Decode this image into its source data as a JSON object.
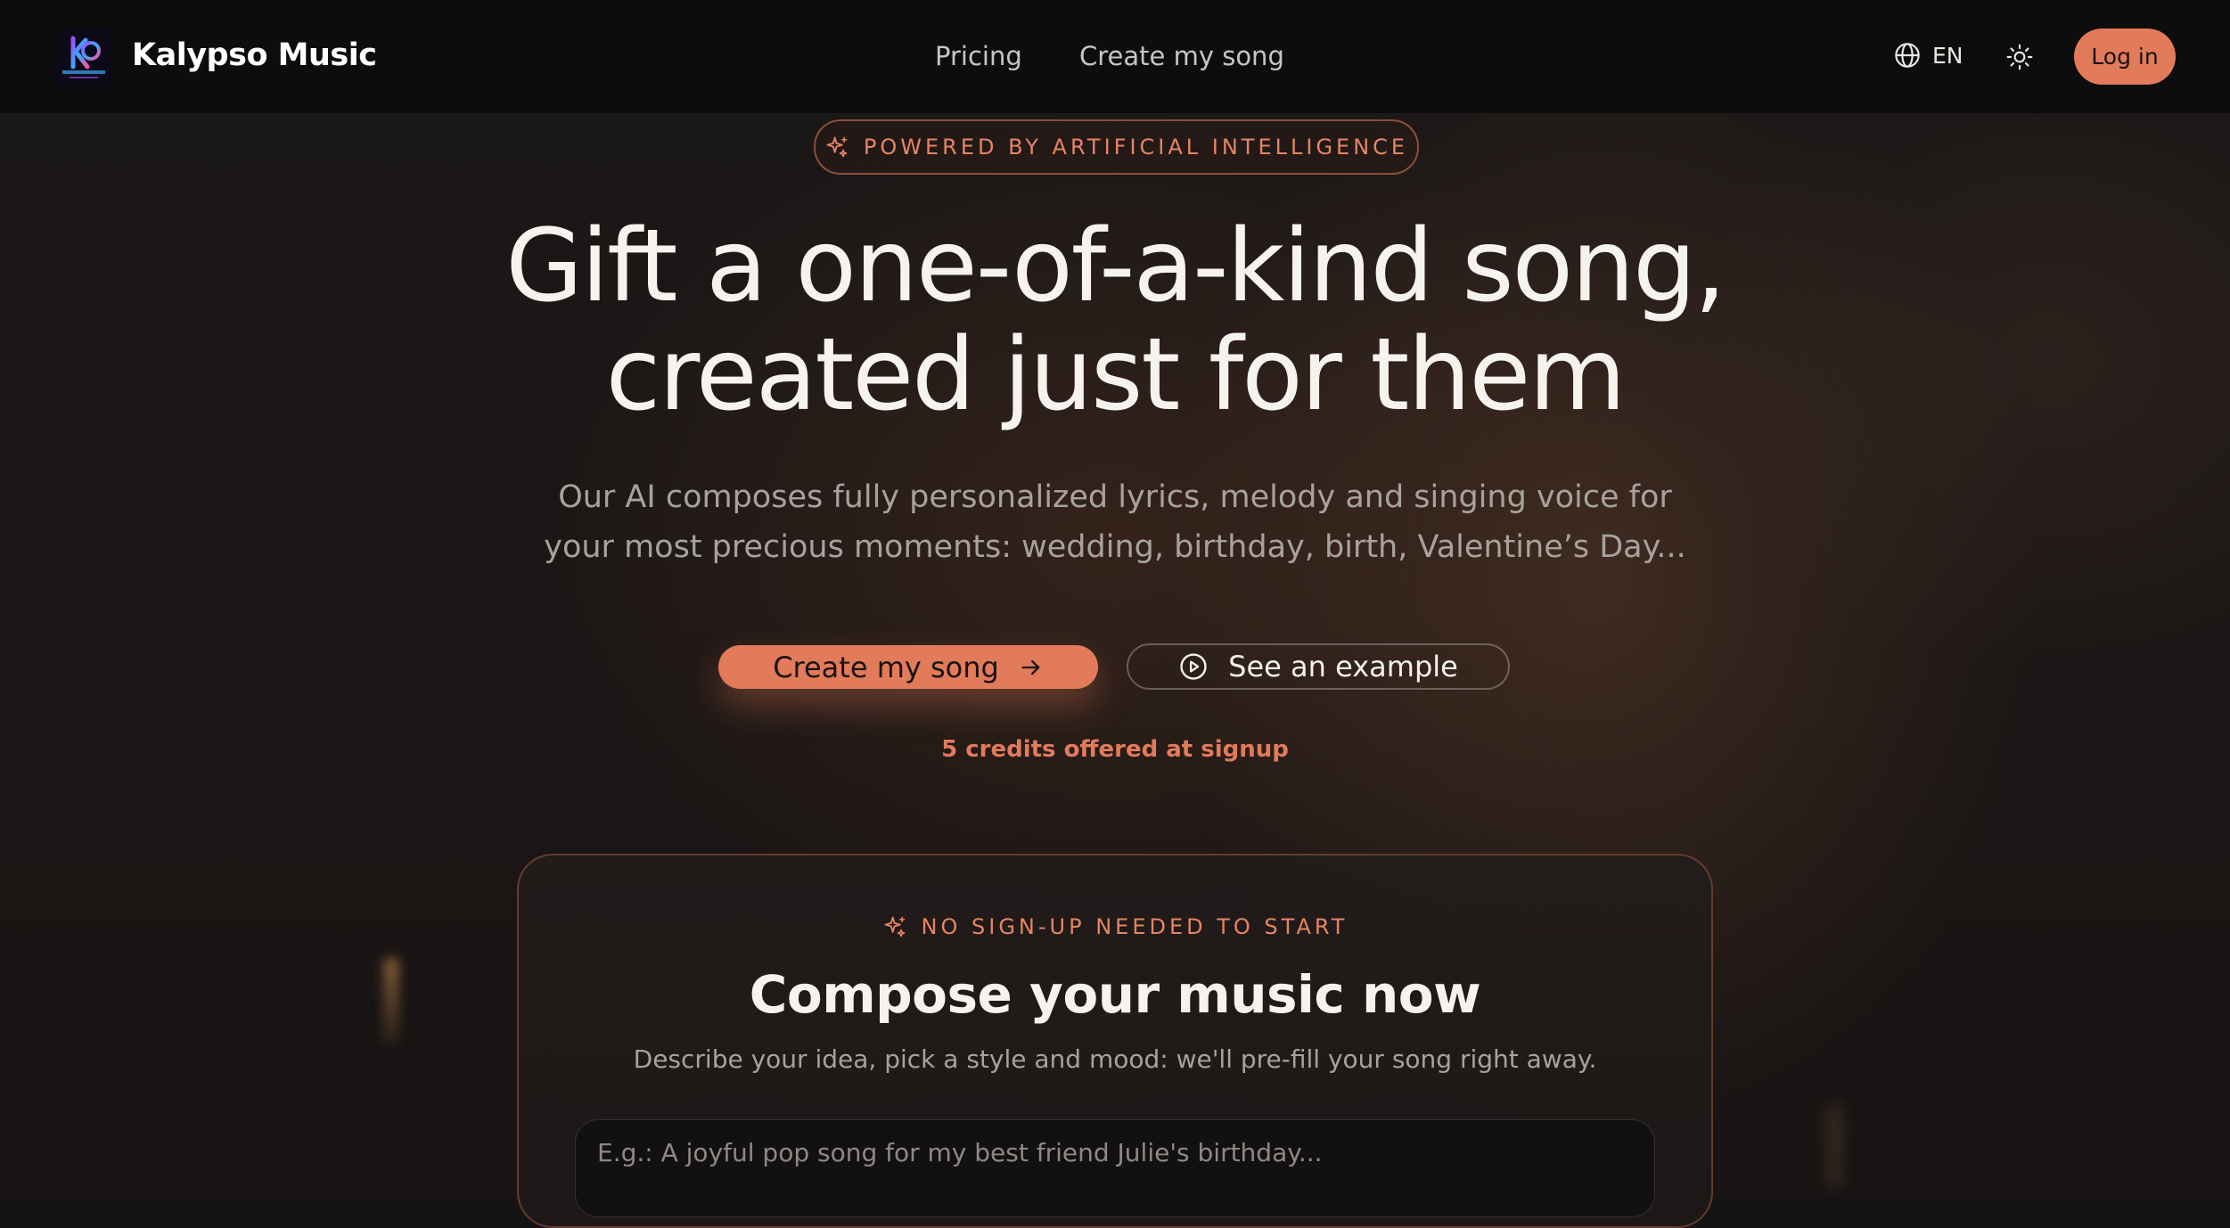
{
  "header": {
    "brand": "Kalypso Music",
    "logo_alt": "KALYPSO",
    "nav": [
      {
        "label": "Pricing"
      },
      {
        "label": "Create my song"
      }
    ],
    "language": "EN",
    "login_label": "Log in"
  },
  "hero": {
    "badge": "POWERED BY ARTIFICIAL INTELLIGENCE",
    "title_line1": "Gift a one-of-a-kind song,",
    "title_line2": "created just for them",
    "subtitle_line1": "Our AI composes fully personalized lyrics, melody and singing voice for",
    "subtitle_line2": "your most precious moments: wedding, birthday, birth, Valentine’s Day...",
    "primary_cta": "Create my song",
    "secondary_cta": "See an example",
    "credits_note": "5 credits offered at signup"
  },
  "compose": {
    "badge": "NO SIGN-UP NEEDED TO START",
    "title": "Compose your music now",
    "subtitle": "Describe your idea, pick a style and mood: we'll pre-fill your song right away.",
    "input_placeholder": "E.g.: A joyful pop song for my best friend Julie's birthday...",
    "input_value": ""
  },
  "colors": {
    "accent": "#e27b5a",
    "header_bg": "#0e0d0d",
    "page_bg": "#1a1616"
  },
  "icons": {
    "lang": "globe-icon",
    "theme": "sun-icon",
    "badge": "sparkle-icon",
    "cta_arrow": "arrow-right-icon",
    "example": "play-circle-icon"
  }
}
